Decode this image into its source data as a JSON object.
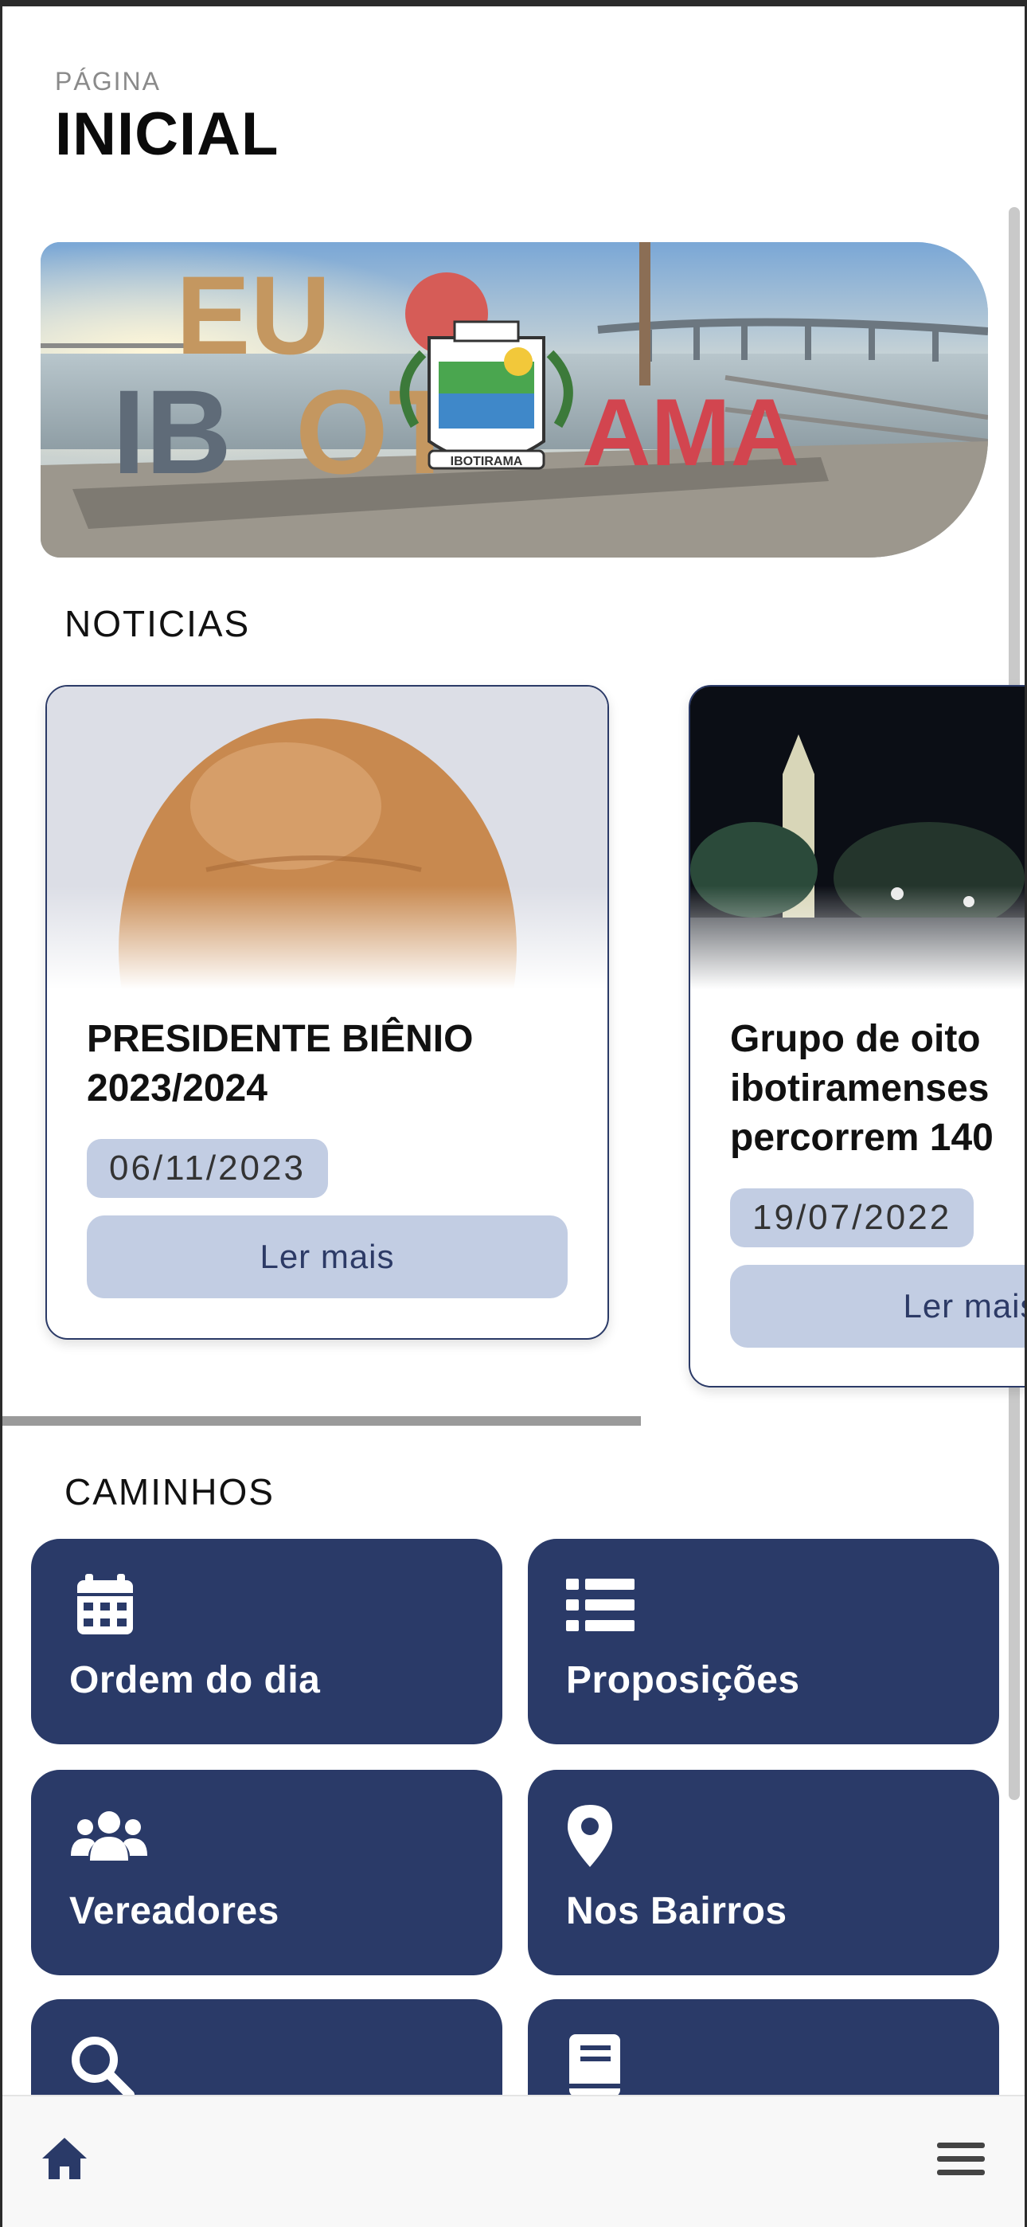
{
  "header": {
    "subtitle": "PÁGINA",
    "title": "INICIAL"
  },
  "hero": {
    "sculpture_lines": [
      "EU",
      "IBOTIRAMA"
    ],
    "seal_text": "IBOTIRAMA"
  },
  "news": {
    "section_title": "NOTICIAS",
    "cards": [
      {
        "title_lines": [
          "PRESIDENTE BIÊNIO",
          "2023/2024"
        ],
        "date": "06/11/2023",
        "button": "Ler mais"
      },
      {
        "title_lines": [
          "Grupo de oito",
          "ibotiramenses",
          "percorrem 140"
        ],
        "date": "19/07/2022",
        "button": "Ler mais"
      }
    ]
  },
  "caminhos": {
    "section_title": "CAMINHOS",
    "tiles": [
      {
        "label": "Ordem do dia",
        "icon": "calendar-icon"
      },
      {
        "label": "Proposições",
        "icon": "list-icon"
      },
      {
        "label": "Vereadores",
        "icon": "users-icon"
      },
      {
        "label": "Nos Bairros",
        "icon": "map-pin-icon"
      },
      {
        "label": "",
        "icon": "search-icon"
      },
      {
        "label": "",
        "icon": "book-icon"
      }
    ]
  },
  "bottom_nav": {
    "home_icon": "home-icon",
    "menu_icon": "hamburger-menu-icon"
  },
  "colors": {
    "tile_bg": "#2a3a68",
    "date_badge_bg": "#c2cde3",
    "card_border": "#2b3a67"
  }
}
